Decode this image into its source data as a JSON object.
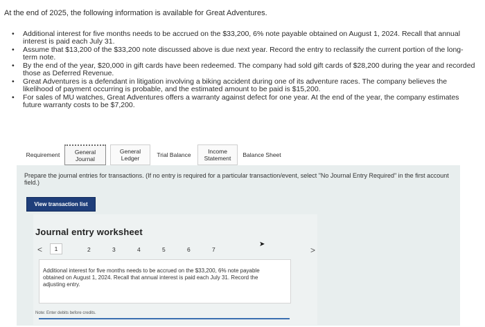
{
  "intro": "At the end of 2025, the following information is available for Great Adventures.",
  "bullets": [
    "Additional interest for five months needs to be accrued on the $33,200, 6% note payable obtained on August 1, 2024. Recall that annual interest is paid each July 31.",
    "Assume that $13,200 of the $33,200 note discussed above is due next year. Record the entry to reclassify the current portion of the long-term note.",
    "By the end of the year, $20,000 in gift cards have been redeemed. The company had sold gift cards of $28,200 during the year and recorded those as Deferred Revenue.",
    "Great Adventures is a defendant in litigation involving a biking accident during one of its adventure races. The company believes the likelihood of payment occurring is probable, and the estimated amount to be paid is $15,200.",
    "For sales of MU watches, Great Adventures offers a warranty against defect for one year. At the end of the year, the company estimates future warranty costs to be $7,200."
  ],
  "tabs": {
    "requirement": "Requirement",
    "general_journal": "General Journal",
    "general_ledger": "General Ledger",
    "trial_balance": "Trial Balance",
    "income_statement": "Income Statement",
    "balance_sheet": "Balance Sheet"
  },
  "instruction": {
    "main": "Prepare the journal entries for transactions.",
    "paren": "(If no entry is required for a particular transaction/event, select \"No Journal Entry Required\" in the first account field.)"
  },
  "view_button": "View transaction list",
  "worksheet": {
    "title": "Journal entry worksheet",
    "pages": [
      "1",
      "2",
      "3",
      "4",
      "5",
      "6",
      "7"
    ],
    "active_page": "1",
    "entry_text": "Additional interest for five months needs to be accrued on the $33,200, 6% note payable obtained on August 1, 2024. Recall that annual interest is paid each July 31. Record the adjusting entry.",
    "note": "Note: Enter debits before credits."
  }
}
